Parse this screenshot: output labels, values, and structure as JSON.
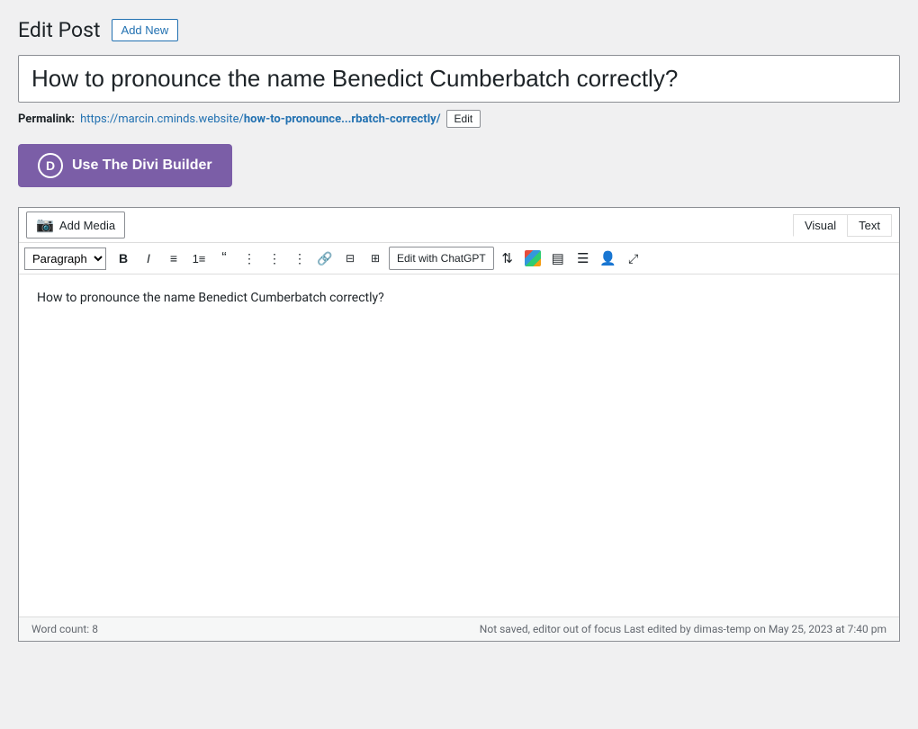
{
  "header": {
    "title": "Edit Post",
    "add_new_label": "Add New"
  },
  "post": {
    "title": "How to pronounce the name Benedict Cumberbatch correctly?",
    "permalink_label": "Permalink:",
    "permalink_url": "https://marcin.cminds.website/how-to-pronounce...rbatch-correctly/",
    "permalink_url_display": "https://marcin.cminds.website/",
    "permalink_slug": "how-to-pronounce...rbatch-correctly/",
    "edit_slug_label": "Edit"
  },
  "divi": {
    "button_label": "Use The Divi Builder",
    "icon_letter": "D"
  },
  "editor": {
    "add_media_label": "Add Media",
    "tab_visual": "Visual",
    "tab_text": "Text",
    "paragraph_option": "Paragraph",
    "chatgpt_label": "Edit with ChatGPT",
    "content": "How to pronounce the name Benedict Cumberbatch correctly?",
    "word_count_label": "Word count:",
    "word_count": "8",
    "status_text": "Not saved, editor out of focus Last edited by dimas-temp on May 25, 2023 at 7:40 pm"
  },
  "toolbar": {
    "bold": "B",
    "italic": "I",
    "ul": "≡",
    "ol": "≡",
    "blockquote": "❝",
    "align_left": "≡",
    "align_center": "≡",
    "align_right": "≡",
    "link": "🔗",
    "unlink": "⊟",
    "table": "⊞",
    "more": "⋯",
    "fullscreen": "⤢"
  }
}
